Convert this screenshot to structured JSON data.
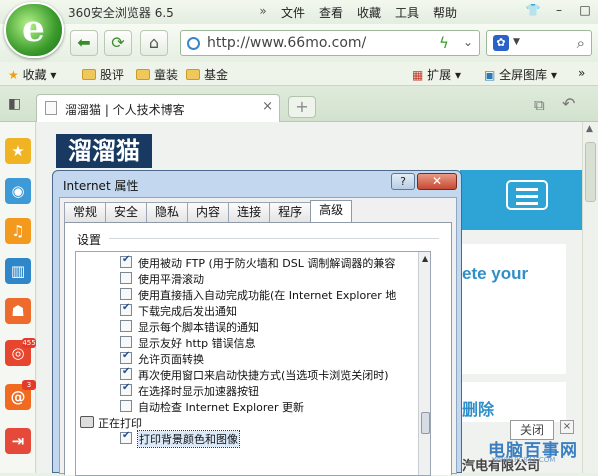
{
  "browser": {
    "title": "360安全浏览器 6.5",
    "menu": [
      "文件",
      "查看",
      "收藏",
      "工具",
      "帮助"
    ],
    "menu_more": "»",
    "url": "http://www.66mo.com/"
  },
  "favorites": {
    "collect_label": "收藏",
    "items": [
      "股评",
      "童装",
      "基金"
    ],
    "extend_label": "扩展",
    "fullscreen_label": "全屏图库"
  },
  "tab": {
    "label": "溜溜猫 | 个人技术博客"
  },
  "page": {
    "logo": "溜溜猫",
    "complete_text": "ete your",
    "delete_text": "删除",
    "close_label": "关闭",
    "company_text": "汽电有限公司",
    "watermark_text": "电脑百事网",
    "watermark_sub": "WWW.PC841.COM"
  },
  "sidebar": {
    "badges": [
      "455",
      "3"
    ]
  },
  "dialog": {
    "title": "Internet 属性",
    "help": "?",
    "tabs": [
      "常规",
      "安全",
      "隐私",
      "内容",
      "连接",
      "程序",
      "高级"
    ],
    "active_tab": "高级",
    "group_label": "设置",
    "settings": [
      {
        "label": "使用被动 FTP (用于防火墙和 DSL 调制解调器的兼容",
        "checked": true
      },
      {
        "label": "使用平滑滚动",
        "checked": false
      },
      {
        "label": "使用直接插入自动完成功能(在 Internet Explorer 地",
        "checked": false
      },
      {
        "label": "下载完成后发出通知",
        "checked": true
      },
      {
        "label": "显示每个脚本错误的通知",
        "checked": false
      },
      {
        "label": "显示友好 http 错误信息",
        "checked": false
      },
      {
        "label": "允许页面转换",
        "checked": true
      },
      {
        "label": "再次使用窗口来启动快捷方式(当选项卡浏览关闭时)",
        "checked": true
      },
      {
        "label": "在选择时显示加速器按钮",
        "checked": true
      },
      {
        "label": "自动检查 Internet Explorer 更新",
        "checked": false
      }
    ],
    "print_group": "正在打印",
    "print_settings": [
      {
        "label": "打印背景颜色和图像",
        "checked": true
      }
    ]
  }
}
